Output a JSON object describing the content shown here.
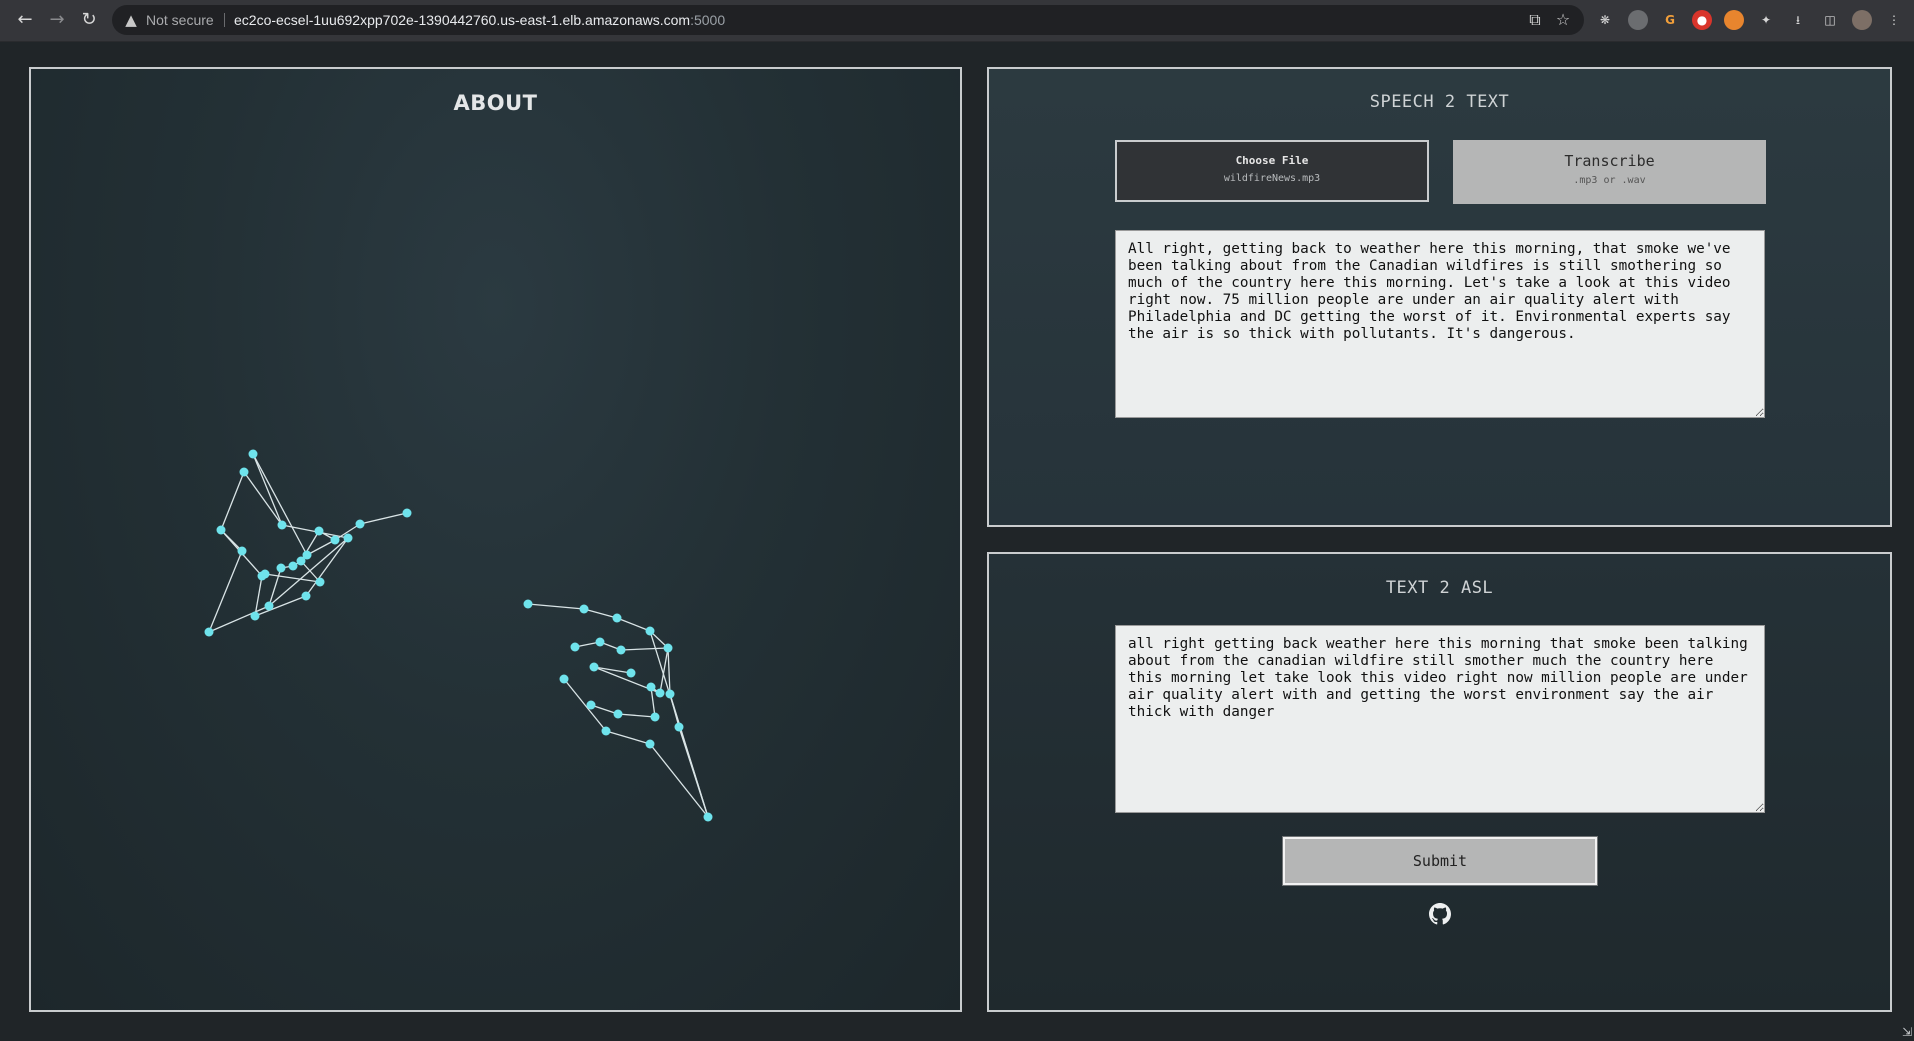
{
  "browser": {
    "security_label": "Not secure",
    "url_host": "ec2co-ecsel-1uu692xpp702e-1390442760.us-east-1.elb.amazonaws.com",
    "url_port": ":5000"
  },
  "about": {
    "title": "ABOUT"
  },
  "speech2text": {
    "title": "SPEECH 2 TEXT",
    "choose_file_label": "Choose File",
    "chosen_file": "wildfireNews.mp3",
    "transcribe_label": "Transcribe",
    "transcribe_hint": ".mp3 or .wav",
    "transcript": "All right, getting back to weather here this morning, that smoke we've been talking about from the Canadian wildfires is still smothering so much of the country here this morning. Let's take a look at this video right now. 75 million people are under an air quality alert with Philadelphia and DC getting the worst of it. Environmental experts say the air is so thick with pollutants. It's dangerous."
  },
  "text2asl": {
    "title": "TEXT 2 ASL",
    "text": "all right getting back weather here this morning that smoke been talking about from the canadian wildfire still smother much the country here this morning let take look this video right now million people are under air quality alert with and getting the worst environment say the air thick with danger",
    "submit_label": "Submit"
  },
  "icons": {
    "github": "github-icon",
    "warning": "warning-icon"
  },
  "colors": {
    "landmark": "#6fe3ec",
    "bone": "#d9e4e6"
  }
}
